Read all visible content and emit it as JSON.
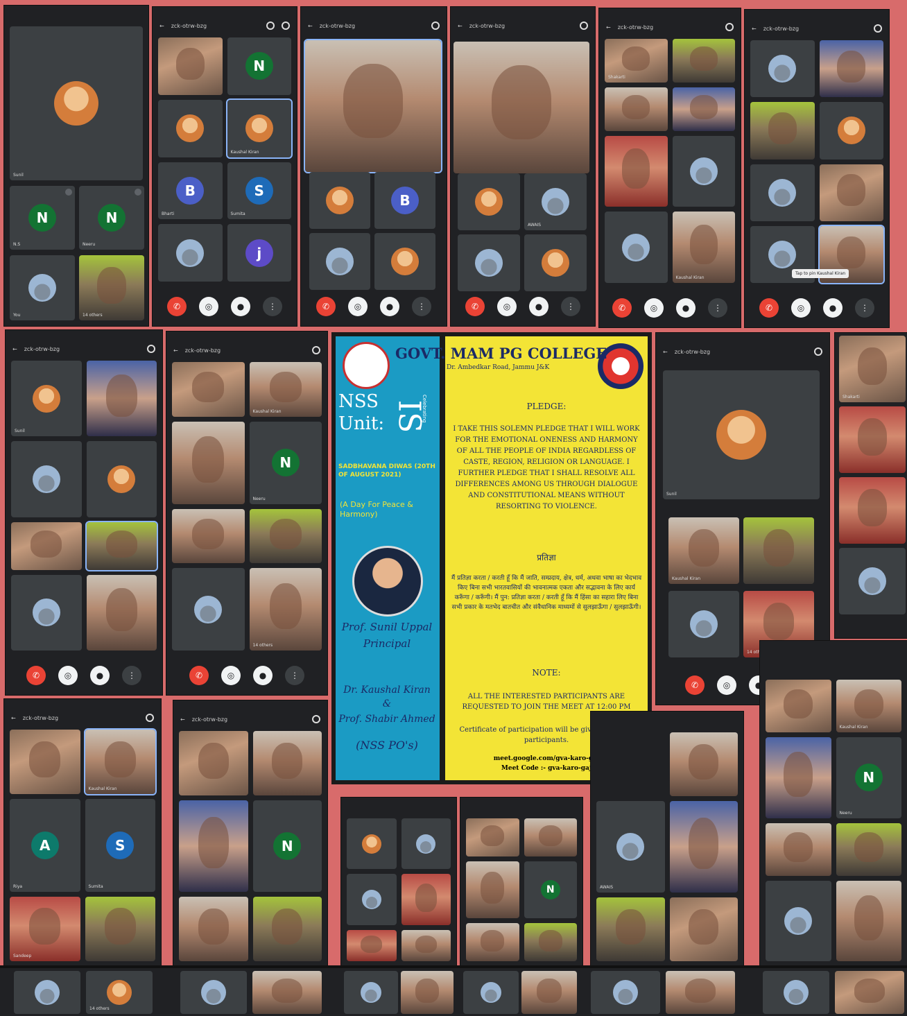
{
  "meet": {
    "meeting_code_short": "zck-otrw-bzg",
    "tile_names": [
      "Sunil",
      "N.S",
      "Neeru",
      "You",
      "Sunil",
      "Kaushal Kiran",
      "Bharti",
      "Sumita",
      "Shakarti",
      "AWAIS",
      "Kaushal Kiran",
      "Neeru",
      "Riya",
      "Sumita",
      "Sandeep"
    ],
    "others_label": "14 others",
    "pin_tooltip": "Tap to pin Kaushal Kiran"
  },
  "poster": {
    "title": "GOVT. MAM PG COLLEGE",
    "address": "Dr. Ambedkar Road, Jammu J&K",
    "nss": "NSS",
    "unit": "Unit:",
    "unit_num": "IS",
    "unit_sub": "Celebrating",
    "event": "SADBHAVANA DIWAS (20TH OF AUGUST 2021)",
    "tagline": "(A Day For Peace & Harmony)",
    "principal_name": "Prof. Sunil Uppal",
    "principal_role": "Principal",
    "pco1": "Dr. Kaushal Kiran",
    "amp": "&",
    "pco2": "Prof. Shabir Ahmed",
    "pco_role": "(NSS PO's)",
    "pledge_heading": "PLEDGE:",
    "pledge_text": "I TAKE THIS SOLEMN PLEDGE THAT I WILL WORK FOR THE EMOTIONAL ONENESS AND HARMONY OF ALL THE PEOPLE OF INDIA REGARDLESS OF CASTE, REGION, RELIGION OR LANGUAGE. I FURTHER PLEDGE THAT I SHALL RESOLVE ALL DIFFERENCES AMONG US THROUGH DIALOGUE AND CONSTITUTIONAL MEANS WITHOUT RESORTING TO VIOLENCE.",
    "hindi_heading": "प्रतिज्ञा",
    "hindi_text": "मैं प्रतिज्ञा करता / करती हूँ कि मैं जाति, सम्प्रदाय, क्षेत्र, धर्म, अथवा भाषा का भेदभाव किए बिना सभी भारतवासियों की भावनात्मक एकता और सद्भावना के लिए कार्य करूँगा / करूँगी। मैं पुन: प्रतिज्ञा करता / करती हूँ कि मैं हिंसा का सहारा लिए बिना सभी प्रकार के मतभेद बातचीत और संवैधानिक माध्यमों से सुलझाऊँगा / सुलझाऊँगी।",
    "note_heading": "NOTE:",
    "note_text": "ALL THE INTERESTED PARTICIPANTS ARE REQUESTED TO JOIN THE MEET AT 12:00 PM",
    "certificate": "Certificate of participation will be given to all the participants.",
    "link": "meet.google.com/gva-karo-gaj",
    "meet_code": "Meet Code :- gva-karo-gaj"
  },
  "colors": {
    "background": "#d86b6b",
    "meet_dark": "#202124",
    "tile": "#3c4043",
    "end_call": "#ea4335",
    "poster_blue": "#1b9bc4",
    "poster_yellow": "#f3e436",
    "poster_text": "#1b2a66"
  }
}
